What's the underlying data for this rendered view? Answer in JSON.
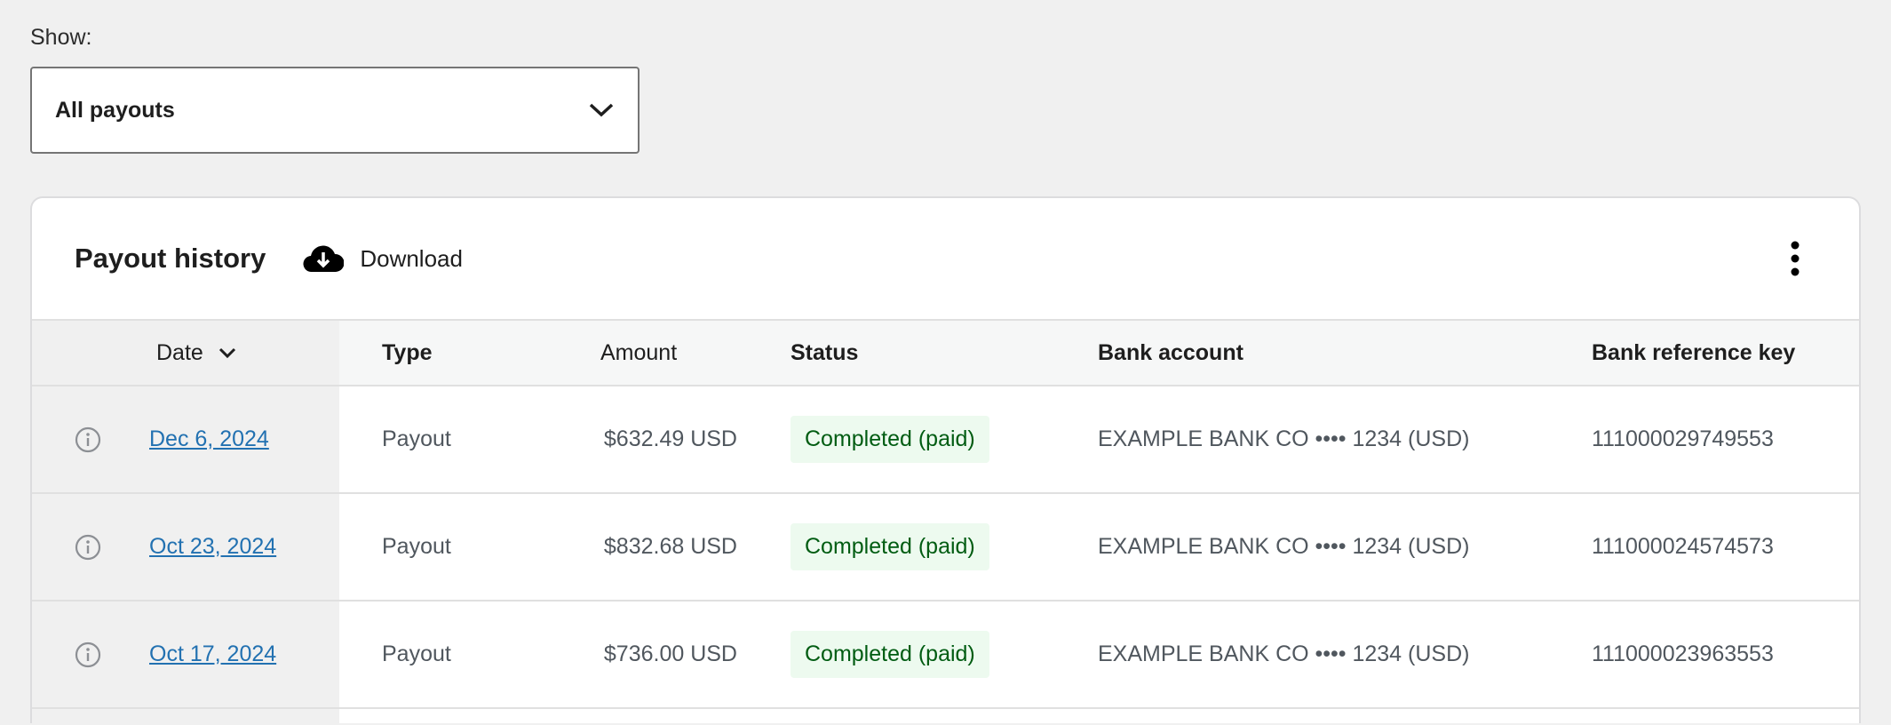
{
  "filter": {
    "label": "Show:",
    "value": "All payouts"
  },
  "card": {
    "title": "Payout history",
    "download": "Download"
  },
  "columns": {
    "date": "Date",
    "type": "Type",
    "amount": "Amount",
    "status": "Status",
    "bank": "Bank account",
    "ref": "Bank reference key"
  },
  "rows": [
    {
      "date": "Dec 6, 2024",
      "type": "Payout",
      "amount": "$632.49 USD",
      "status": "Completed (paid)",
      "bank": "EXAMPLE BANK CO •••• 1234 (USD)",
      "ref": "111000029749553"
    },
    {
      "date": "Oct 23, 2024",
      "type": "Payout",
      "amount": "$832.68 USD",
      "status": "Completed (paid)",
      "bank": "EXAMPLE BANK CO •••• 1234 (USD)",
      "ref": "111000024574573"
    },
    {
      "date": "Oct 17, 2024",
      "type": "Payout",
      "amount": "$736.00 USD",
      "status": "Completed (paid)",
      "bank": "EXAMPLE BANK CO •••• 1234 (USD)",
      "ref": "111000023963553"
    }
  ]
}
